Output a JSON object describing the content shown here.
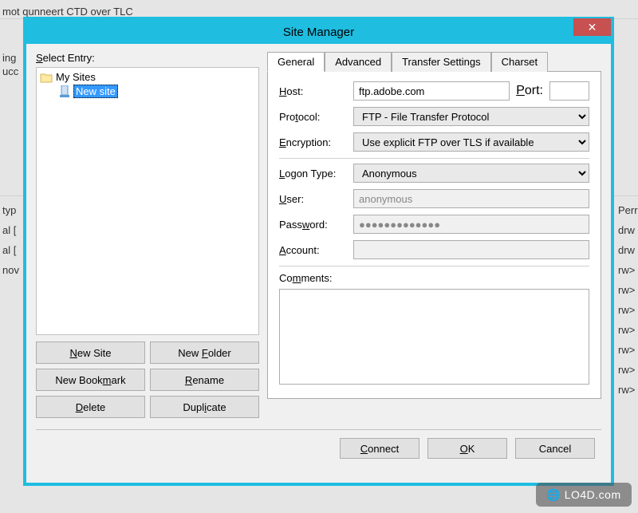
{
  "background": {
    "frag1": "mot qunneert CTD over TLC",
    "frag2": "ing",
    "frag3": "ucc",
    "frag4": "typ",
    "frag5": "al [",
    "frag6": "al [",
    "frag7": "nov",
    "frag_right": "Perr",
    "frag_r2": "drw",
    "frag_r3": "drw",
    "frag_r4": "rw>",
    "frag_r5": "rw>",
    "frag_r6": "rw>",
    "frag_r7": "rw>",
    "frag_r8": "rw>",
    "frag_r9": "rw>",
    "frag_r10": "rw>"
  },
  "dialog": {
    "title": "Site Manager",
    "close_glyph": "✕",
    "select_entry_label": "Select Entry:",
    "tree": {
      "root": "My Sites",
      "child": "New site"
    },
    "buttons": {
      "new_site": "New Site",
      "new_folder": "New Folder",
      "new_bookmark": "New Bookmark",
      "rename": "Rename",
      "delete": "Delete",
      "duplicate": "Duplicate"
    },
    "tabs": {
      "general": "General",
      "advanced": "Advanced",
      "transfer_settings": "Transfer Settings",
      "charset": "Charset"
    },
    "form": {
      "host_label": "Host:",
      "host_value": "ftp.adobe.com",
      "port_label": "Port:",
      "port_value": "",
      "protocol_label": "Protocol:",
      "protocol_value": "FTP - File Transfer Protocol",
      "encryption_label": "Encryption:",
      "encryption_value": "Use explicit FTP over TLS if available",
      "logon_type_label": "Logon Type:",
      "logon_type_value": "Anonymous",
      "user_label": "User:",
      "user_value": "anonymous",
      "password_label": "Password:",
      "password_value": "●●●●●●●●●●●●●",
      "account_label": "Account:",
      "account_value": "",
      "comments_label": "Comments:",
      "comments_value": ""
    },
    "bottom_buttons": {
      "connect": "Connect",
      "ok": "OK",
      "cancel": "Cancel"
    }
  },
  "watermark": "LO4D.com"
}
